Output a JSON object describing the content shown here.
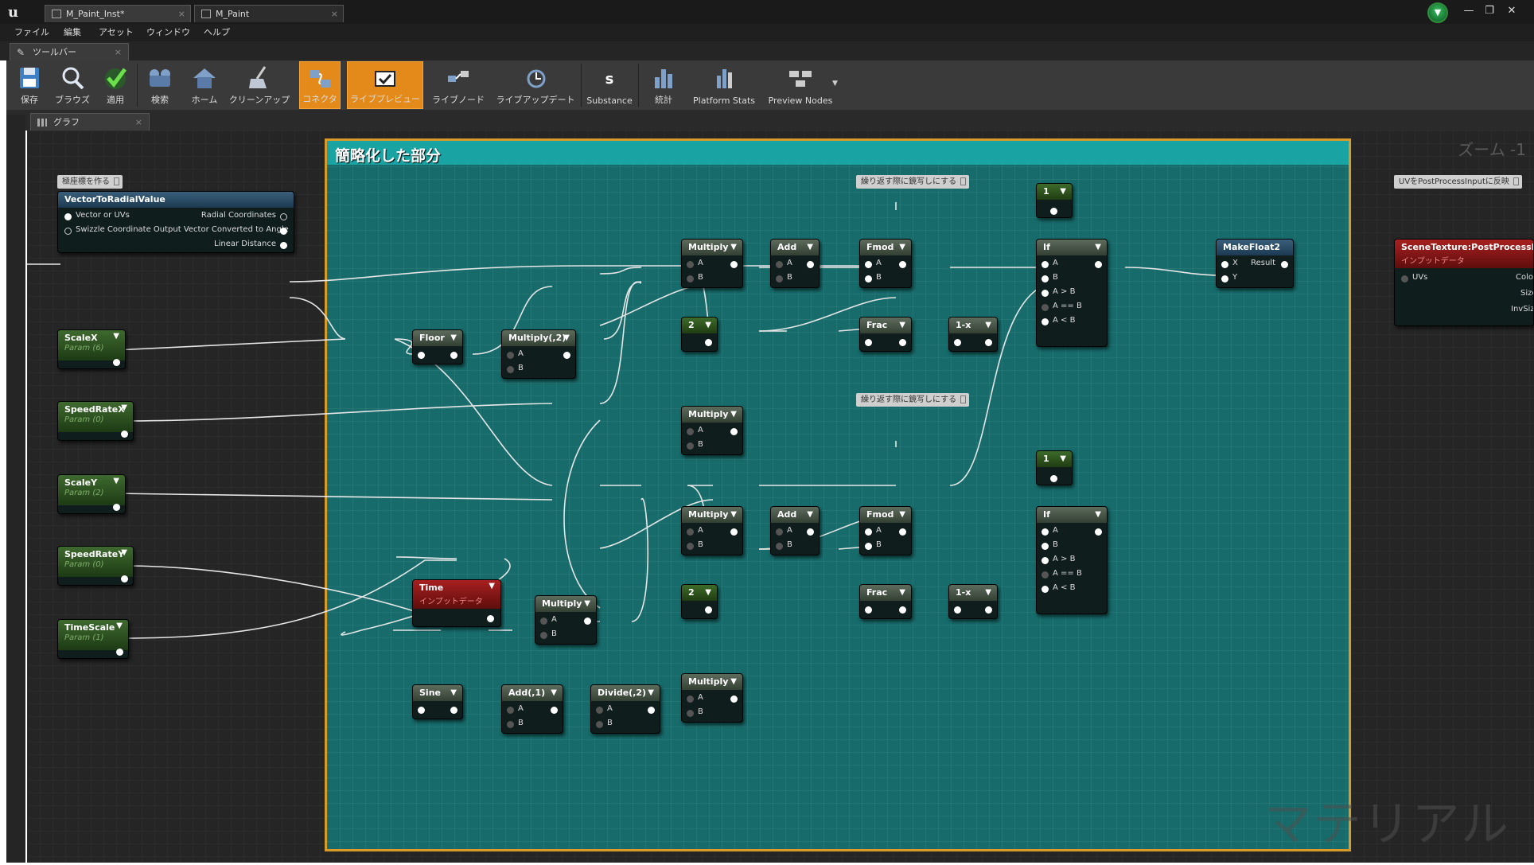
{
  "window": {
    "tabs": [
      {
        "label": "M_Paint_Inst*"
      },
      {
        "label": "M_Paint"
      }
    ],
    "controls": [
      "—",
      "❐",
      "✕"
    ]
  },
  "menu": [
    "ファイル",
    "編集",
    "アセット",
    "ウィンドウ",
    "ヘルプ"
  ],
  "toolbar_tab": {
    "label": "ツールバー"
  },
  "toolbar": {
    "buttons": [
      {
        "label": "保存",
        "icon": "save-icon"
      },
      {
        "label": "ブラウズ",
        "icon": "browse-icon"
      },
      {
        "label": "適用",
        "icon": "apply-icon"
      },
      {
        "label": "検索",
        "icon": "search-icon"
      },
      {
        "label": "ホーム",
        "icon": "home-icon"
      },
      {
        "label": "クリーンアップ",
        "icon": "cleanup-icon"
      },
      {
        "label": "コネクタ",
        "icon": "connector-icon"
      },
      {
        "label": "ライブプレビュー",
        "icon": "live-preview-icon"
      },
      {
        "label": "ライブノード",
        "icon": "live-node-icon"
      },
      {
        "label": "ライブアップデート",
        "icon": "live-update-icon"
      },
      {
        "label": "Substance",
        "icon": "substance-icon"
      },
      {
        "label": "統計",
        "icon": "stats-icon"
      },
      {
        "label": "Platform Stats",
        "icon": "platform-stats-icon"
      },
      {
        "label": "Preview Nodes",
        "icon": "preview-nodes-icon"
      }
    ]
  },
  "graph_tab": {
    "label": "グラフ"
  },
  "graph": {
    "zoom": "ズーム -1",
    "watermark": "マテリアル",
    "comment_title": "簡略化した部分",
    "comments": {
      "polar": "極座標を作る",
      "mirror1": "繰り返す際に鏡写しにする",
      "mirror2": "繰り返す際に鏡写しにする",
      "uv_reflect": "UVをPostProcessInputに反映"
    }
  },
  "nodes": {
    "vtr": {
      "title": "VectorToRadialValue",
      "pins": [
        "Vector or UVs",
        "Radial Coordinates",
        "Swizzle Coordinate Output Vector Converted to Angle",
        "Linear Distance"
      ]
    },
    "scalex": {
      "title": "ScaleX",
      "sub": "Param (6)"
    },
    "speedx": {
      "title": "SpeedRateX",
      "sub": "Param (0)"
    },
    "scaley": {
      "title": "ScaleY",
      "sub": "Param (2)"
    },
    "speedy": {
      "title": "SpeedRateY",
      "sub": "Param (0)"
    },
    "timescale": {
      "title": "TimeScale",
      "sub": "Param (1)"
    },
    "floor": {
      "title": "Floor"
    },
    "mul2": {
      "title": "Multiply(,2)"
    },
    "mul_a": {
      "title": "Multiply"
    },
    "add_a": {
      "title": "Add"
    },
    "fmod_a": {
      "title": "Fmod"
    },
    "const2_a": {
      "title": "2"
    },
    "frac_a": {
      "title": "Frac"
    },
    "omx_a": {
      "title": "1-x"
    },
    "const1_a": {
      "title": "1"
    },
    "if_a": {
      "title": "If"
    },
    "mul_b": {
      "title": "Multiply"
    },
    "mul_c": {
      "title": "Multiply"
    },
    "add_c": {
      "title": "Add"
    },
    "fmod_c": {
      "title": "Fmod"
    },
    "const2_c": {
      "title": "2"
    },
    "frac_c": {
      "title": "Frac"
    },
    "omx_c": {
      "title": "1-x"
    },
    "const1_c": {
      "title": "1"
    },
    "if_c": {
      "title": "If"
    },
    "time": {
      "title": "Time",
      "sub": "インプットデータ"
    },
    "mul_t": {
      "title": "Multiply"
    },
    "sine": {
      "title": "Sine"
    },
    "add1": {
      "title": "Add(,1)"
    },
    "div2": {
      "title": "Divide(,2)"
    },
    "mul_d": {
      "title": "Multiply"
    },
    "makefloat2": {
      "title": "MakeFloat2",
      "pins": [
        "X",
        "Result",
        "Y"
      ]
    },
    "scenetex": {
      "title": "SceneTexture:PostProcessInput",
      "sub": "インプットデータ",
      "pins": [
        "UVs",
        "Color",
        "Size",
        "InvSize"
      ]
    },
    "if_pins": [
      "A",
      "B",
      "A > B",
      "A == B",
      "A < B"
    ],
    "ab_pins": [
      "A",
      "B"
    ]
  }
}
